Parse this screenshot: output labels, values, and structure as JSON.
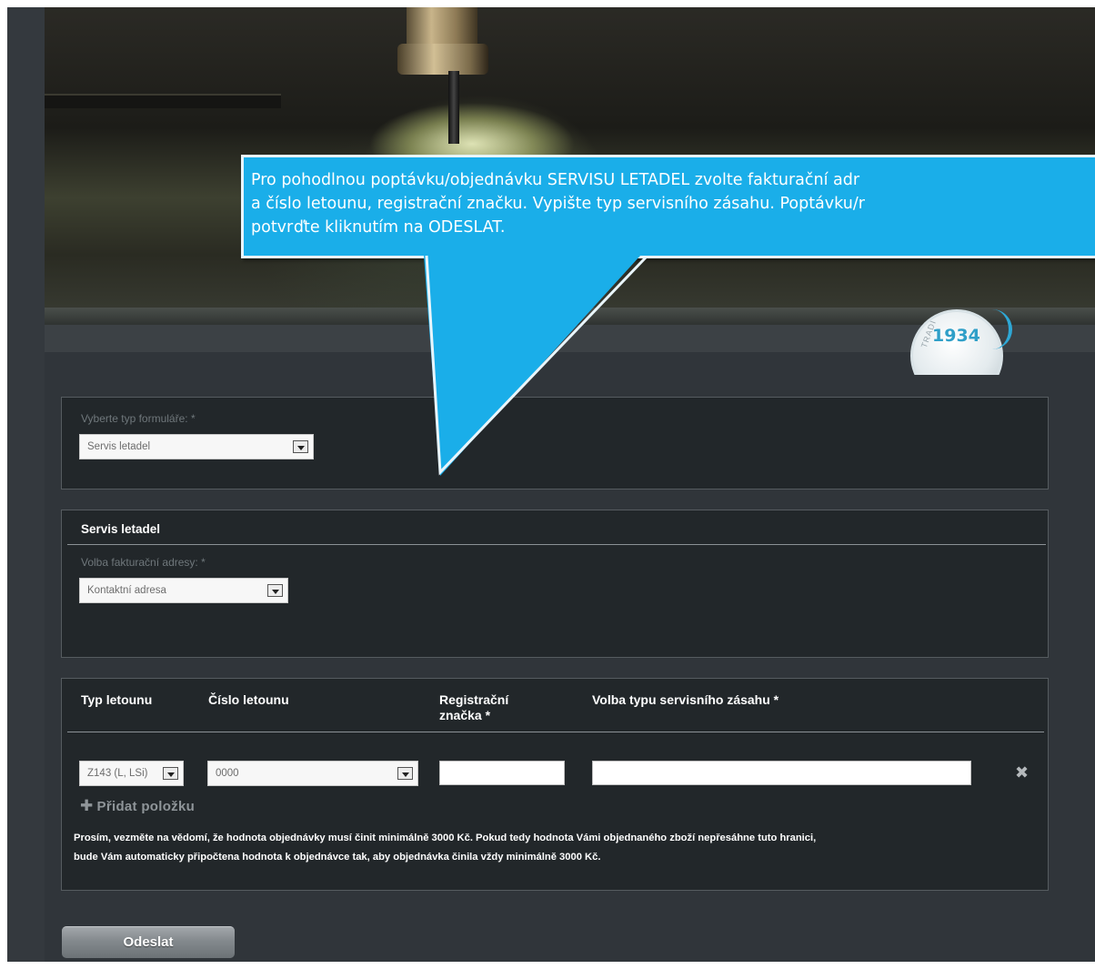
{
  "callout": {
    "lines": [
      "Pro pohodlnou poptávku/objednávku SERVISU LETADEL zvolte fakturační adr",
      "a číslo letounu, registrační značku. Vypište typ servisního zásahu. Poptávku/r",
      "potvrďte kliknutím na ODESLAT."
    ]
  },
  "badge": {
    "year": "1934",
    "text": "TRADI"
  },
  "form_type": {
    "label": "Vyberte typ formuláře: *",
    "selected": "Servis letadel"
  },
  "service": {
    "title": "Servis letadel",
    "billing_label": "Volba fakturační adresy: *",
    "billing_selected": "Kontaktní adresa"
  },
  "items": {
    "headers": {
      "type": "Typ letounu",
      "number": "Číslo letounu",
      "registration_line1": "Registrační",
      "registration_line2": "značka *",
      "service_type": "Volba typu servisního zásahu *"
    },
    "rows": [
      {
        "type": "Z143 (L, LSi)",
        "number": "0000",
        "registration": "",
        "service_type": ""
      }
    ],
    "remove_icon": "close-icon",
    "add_label": "Přidat položku",
    "notice_line1": "Prosím, vezměte na vědomí, že hodnota objednávky musí činit minimálně 3000 Kč. Pokud tedy hodnota Vámi objednaného zboží nepřesáhne tuto hranici,",
    "notice_line2": "bude Vám automaticky připočtena hodnota k objednávce tak, aby objednávka činila vždy minimálně 3000 Kč."
  },
  "submit_label": "Odeslat",
  "colors": {
    "callout_bg": "#1aaee9",
    "page_bg": "#30353a",
    "panel_bg": "#22272a"
  }
}
